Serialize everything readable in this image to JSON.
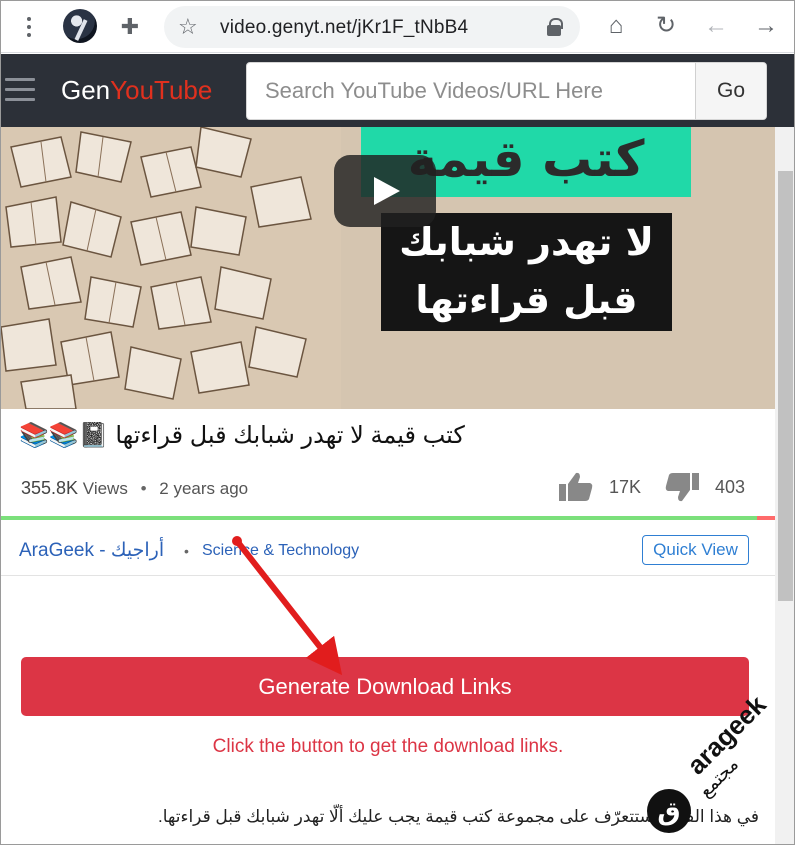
{
  "browser": {
    "url": "video.genyt.net/jKr1F_tNbB4",
    "icons": [
      "menu-icon",
      "avatar",
      "extensions-icon",
      "star-icon",
      "lock-icon",
      "home-icon",
      "reload-icon",
      "back-icon",
      "forward-icon"
    ]
  },
  "header": {
    "logo_part1": "Gen",
    "logo_part2": "YouTube",
    "search_placeholder": "Search YouTube Videos/URL Here",
    "go_label": "Go",
    "accent_color": "#e0301e"
  },
  "video": {
    "thumbnail_green_text": "كتب قيمة",
    "thumbnail_black_line1": "لا تهدر شبابك",
    "thumbnail_black_line2": "قبل قراءتها",
    "title": "كتب قيمة لا تهدر شبابك قبل قراءتها",
    "title_icons": "📓📚📚",
    "views": "355.8K",
    "views_label": "Views",
    "age": "2 years ago",
    "likes": "17K",
    "dislikes": "403",
    "like_ratio": 0.977
  },
  "channel": {
    "name": "AraGeek - أراجيك",
    "category": "Science & Technology",
    "quick_view_label": "Quick View"
  },
  "actions": {
    "generate_label": "Generate Download Links",
    "hint": "Click the button to get the download links.",
    "button_color": "#dc3545"
  },
  "description": "في هذا الفيديو ستتعرّف على مجموعة كتب قيمة يجب عليك ألّا تهدر شبابك قبل قراءتها.",
  "watermark": {
    "brand": "arageek",
    "sub": "مجتمع",
    "badge": "ق"
  }
}
